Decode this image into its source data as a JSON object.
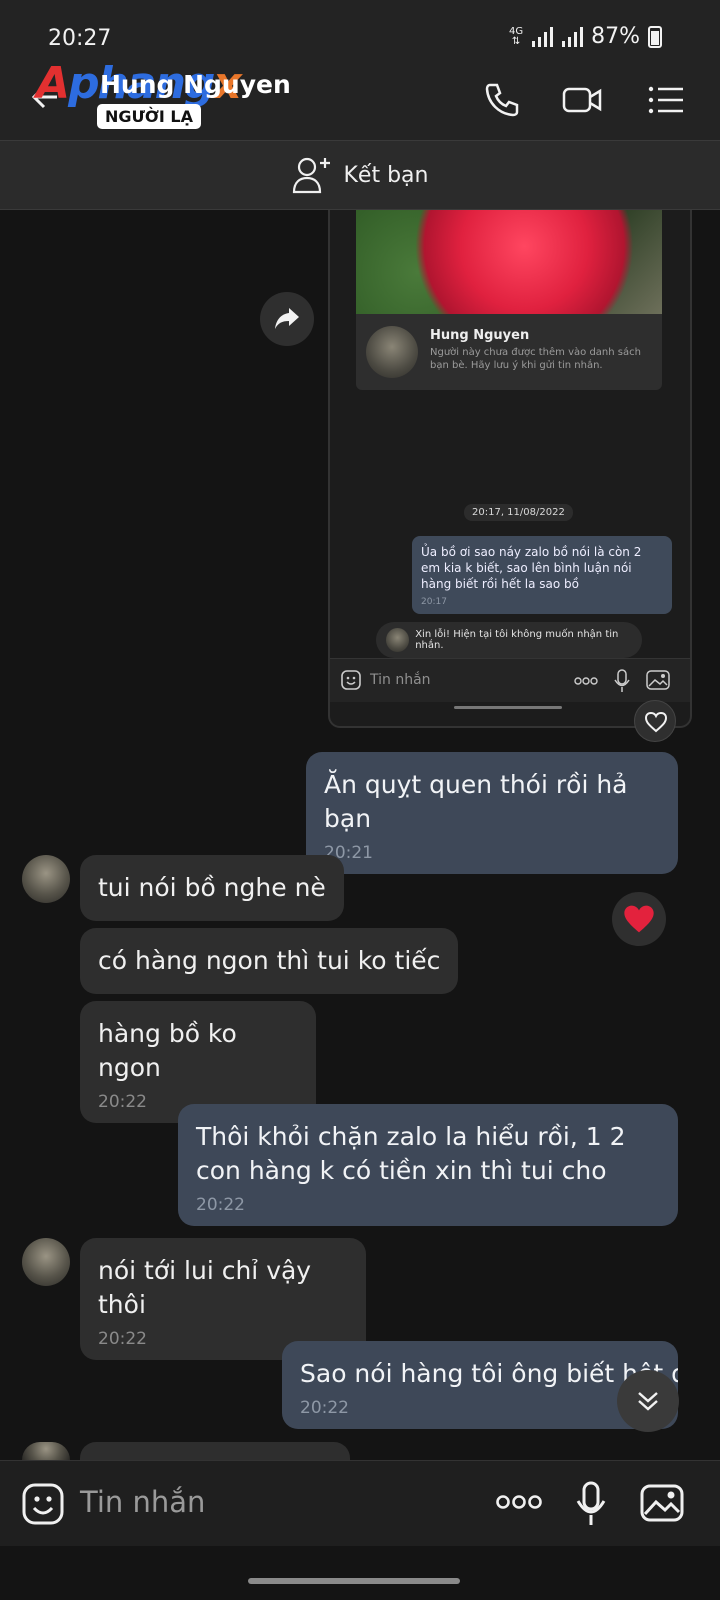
{
  "status": {
    "time": "20:27",
    "network": "4G",
    "battery": "87%"
  },
  "header": {
    "watermark": "Aphangx",
    "contact_name": "Hung Nguyen",
    "stranger_badge": "NGƯỜI LẠ",
    "icons": [
      "back-arrow-icon",
      "phone-icon",
      "video-call-icon",
      "menu-icon"
    ]
  },
  "add_friend": {
    "label": "Kết bạn"
  },
  "screenshot": {
    "profile_name": "Hung Nguyen",
    "profile_note": "Người này chưa được thêm vào danh sách bạn bè. Hãy lưu ý khi gửi tin nhắn.",
    "date": "20:17, 11/08/2022",
    "message": "Ủa bồ ơi sao náy zalo bồ nói là còn 2 em kia k biết, sao lên bình luận nói hàng biết rồi hết la sao bồ",
    "message_time": "20:17",
    "reject_notice": "Xin lỗi! Hiện tại tôi không muốn nhận tin nhắn.",
    "input_placeholder": "Tin nhắn"
  },
  "messages": [
    {
      "dir": "out",
      "text": "Ăn quỵt quen thói rồi hả bạn",
      "time": "20:21"
    },
    {
      "dir": "in",
      "text": "tui nói bồ nghe nè"
    },
    {
      "dir": "in",
      "text": "có hàng ngon thì tui ko tiếc"
    },
    {
      "dir": "in",
      "text": "hàng bồ ko ngon",
      "time": "20:22"
    },
    {
      "dir": "out",
      "text": "Thôi khỏi chặn zalo la hiểu rồi, 1 2 con hàng k có tiền xin thì tui cho",
      "time": "20:22"
    },
    {
      "dir": "in",
      "text": "nói tới lui chỉ vậy thôi",
      "time": "20:22"
    },
    {
      "dir": "out",
      "text": "Sao nói hàng tôi ông biết hêt đ",
      "time": "20:22"
    }
  ],
  "composer": {
    "placeholder": "Tin nhắn"
  }
}
